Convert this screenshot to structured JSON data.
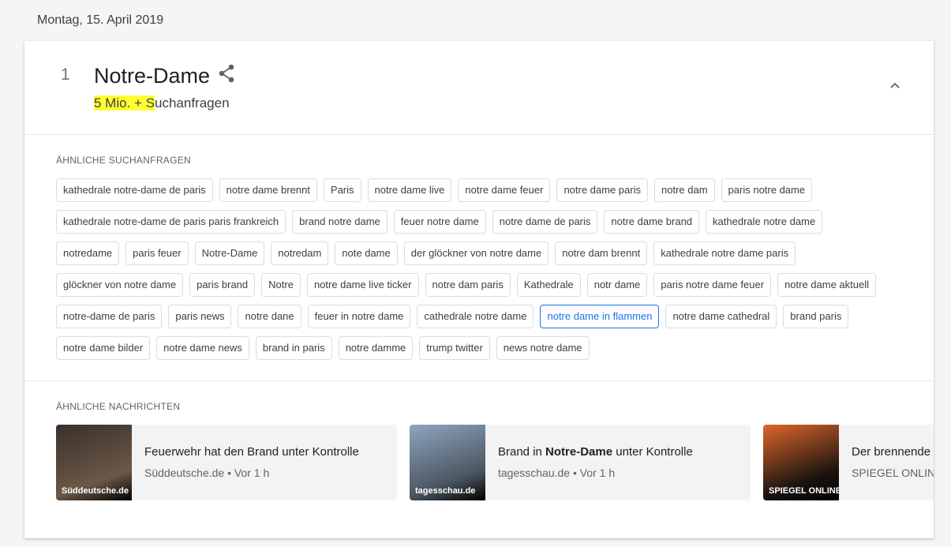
{
  "date": "Montag, 15. April 2019",
  "trend": {
    "rank": "1",
    "title": "Notre-Dame",
    "searches_highlight": "5 Mio. + S",
    "searches_rest": "uchanfragen"
  },
  "related_queries": {
    "label": "ÄHNLICHE SUCHANFRAGEN",
    "active": "notre dame in flammen",
    "rows": [
      [
        "kathedrale notre-dame de paris",
        "notre dame brennt",
        "Paris",
        "notre dame live",
        "notre dame feuer",
        "notre dame paris",
        "notre dam",
        "paris notre dame"
      ],
      [
        "kathedrale notre-dame de paris paris frankreich",
        "brand notre dame",
        "feuer notre dame",
        "notre dame de paris",
        "notre dame brand",
        "kathedrale notre dame"
      ],
      [
        "notredame",
        "paris feuer",
        "Notre-Dame",
        "notredam",
        "note dame",
        "der glöckner von notre dame",
        "notre dam brennt",
        "kathedrale notre dame paris"
      ],
      [
        "glöckner von notre dame",
        "paris brand",
        "Notre",
        "notre dame live ticker",
        "notre dam paris",
        "Kathedrale",
        "notr dame",
        "paris notre dame feuer",
        "notre dame aktuell"
      ],
      [
        "notre-dame de paris",
        "paris news",
        "notre dane",
        "feuer in notre dame",
        "cathedrale notre dame",
        "notre dame in flammen",
        "notre dame cathedral",
        "brand paris"
      ],
      [
        "notre dame bilder",
        "notre dame news",
        "brand in paris",
        "notre damme",
        "trump twitter",
        "news notre dame"
      ]
    ]
  },
  "related_news": {
    "label": "ÄHNLICHE NACHRICHTEN",
    "items": [
      {
        "title_parts": [
          {
            "t": "Feuerwehr hat den Brand unter Kontrolle",
            "b": false
          }
        ],
        "source": "Süddeutsche.de",
        "meta": "Süddeutsche.de • Vor 1 h",
        "colors": [
          "#3a2f2a",
          "#6b5848"
        ]
      },
      {
        "title_parts": [
          {
            "t": "Brand in ",
            "b": false
          },
          {
            "t": "Notre-Dame",
            "b": true
          },
          {
            "t": " unter Kontrolle",
            "b": false
          }
        ],
        "source": "tagesschau.de",
        "meta": "tagesschau.de • Vor 1 h",
        "colors": [
          "#8fa6c0",
          "#4a5560"
        ]
      },
      {
        "title_parts": [
          {
            "t": "Der brennende K",
            "b": false
          }
        ],
        "source": "SPIEGEL ONLINE",
        "meta": "SPIEGEL ONLINE",
        "colors": [
          "#e0662a",
          "#1a1410"
        ]
      }
    ]
  }
}
